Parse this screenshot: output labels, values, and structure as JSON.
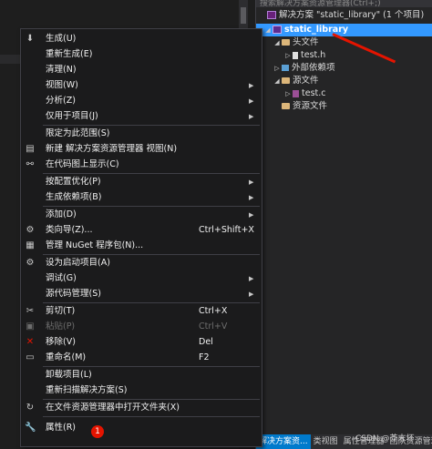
{
  "solution_explorer": {
    "search_placeholder": "搜索解决方案资源管理器(Ctrl+;)",
    "tree": [
      {
        "label": "解决方案 \"static_library\" (1 个项目)",
        "icon": "solution-icon",
        "toggle": ""
      },
      {
        "label": "static_library",
        "icon": "project-icon",
        "toggle": "◢",
        "selected": true
      },
      {
        "label": "头文件",
        "icon": "folder-icon",
        "toggle": "◢"
      },
      {
        "label": "test.h",
        "icon": "header-file-icon",
        "toggle": "▷"
      },
      {
        "label": "外部依赖项",
        "icon": "references-icon",
        "toggle": "▷"
      },
      {
        "label": "源文件",
        "icon": "folder-icon",
        "toggle": "◢"
      },
      {
        "label": "test.c",
        "icon": "c-file-icon",
        "toggle": "▷"
      },
      {
        "label": "资源文件",
        "icon": "folder-icon",
        "toggle": ""
      }
    ],
    "tabs": [
      "解决方案资...",
      "类视图",
      "属性管理器",
      "团队资源管理器"
    ],
    "watermark": "CSDN @芥末坏"
  },
  "context_menu": {
    "items": [
      {
        "label": "生成(U)",
        "icon": "build-icon",
        "shortcut": "",
        "submenu": false
      },
      {
        "label": "重新生成(E)",
        "icon": "",
        "shortcut": "",
        "submenu": false
      },
      {
        "label": "清理(N)",
        "icon": "",
        "shortcut": "",
        "submenu": false
      },
      {
        "label": "视图(W)",
        "icon": "",
        "shortcut": "",
        "submenu": true
      },
      {
        "label": "分析(Z)",
        "icon": "",
        "shortcut": "",
        "submenu": true
      },
      {
        "label": "仅用于项目(J)",
        "icon": "",
        "shortcut": "",
        "submenu": true
      },
      {
        "label": "限定为此范围(S)",
        "icon": "",
        "shortcut": "",
        "submenu": false
      },
      {
        "label": "新建 解决方案资源管理器 视图(N)",
        "icon": "new-view-icon",
        "shortcut": "",
        "submenu": false
      },
      {
        "label": "在代码图上显示(C)",
        "icon": "code-map-icon",
        "shortcut": "",
        "submenu": false
      },
      {
        "label": "按配置优化(P)",
        "icon": "",
        "shortcut": "",
        "submenu": true
      },
      {
        "label": "生成依赖项(B)",
        "icon": "",
        "shortcut": "",
        "submenu": true
      },
      {
        "label": "添加(D)",
        "icon": "",
        "shortcut": "",
        "submenu": true
      },
      {
        "label": "类向导(Z)...",
        "icon": "class-wizard-icon",
        "shortcut": "Ctrl+Shift+X",
        "submenu": false
      },
      {
        "label": "管理 NuGet 程序包(N)...",
        "icon": "nuget-icon",
        "shortcut": "",
        "submenu": false
      },
      {
        "label": "设为启动项目(A)",
        "icon": "gear-icon",
        "shortcut": "",
        "submenu": false
      },
      {
        "label": "调试(G)",
        "icon": "",
        "shortcut": "",
        "submenu": true
      },
      {
        "label": "源代码管理(S)",
        "icon": "",
        "shortcut": "",
        "submenu": true
      },
      {
        "label": "剪切(T)",
        "icon": "scissors-icon",
        "shortcut": "Ctrl+X",
        "submenu": false
      },
      {
        "label": "粘贴(P)",
        "icon": "paste-icon",
        "shortcut": "Ctrl+V",
        "submenu": false,
        "disabled": true
      },
      {
        "label": "移除(V)",
        "icon": "remove-icon",
        "shortcut": "Del",
        "submenu": false
      },
      {
        "label": "重命名(M)",
        "icon": "rename-icon",
        "shortcut": "F2",
        "submenu": false
      },
      {
        "label": "卸载项目(L)",
        "icon": "",
        "shortcut": "",
        "submenu": false
      },
      {
        "label": "重新扫描解决方案(S)",
        "icon": "",
        "shortcut": "",
        "submenu": false
      },
      {
        "label": "在文件资源管理器中打开文件夹(X)",
        "icon": "open-folder-icon",
        "shortcut": "",
        "submenu": false
      },
      {
        "label": "属性(R)",
        "icon": "wrench-icon",
        "shortcut": "",
        "submenu": false
      }
    ],
    "badge": "1"
  }
}
